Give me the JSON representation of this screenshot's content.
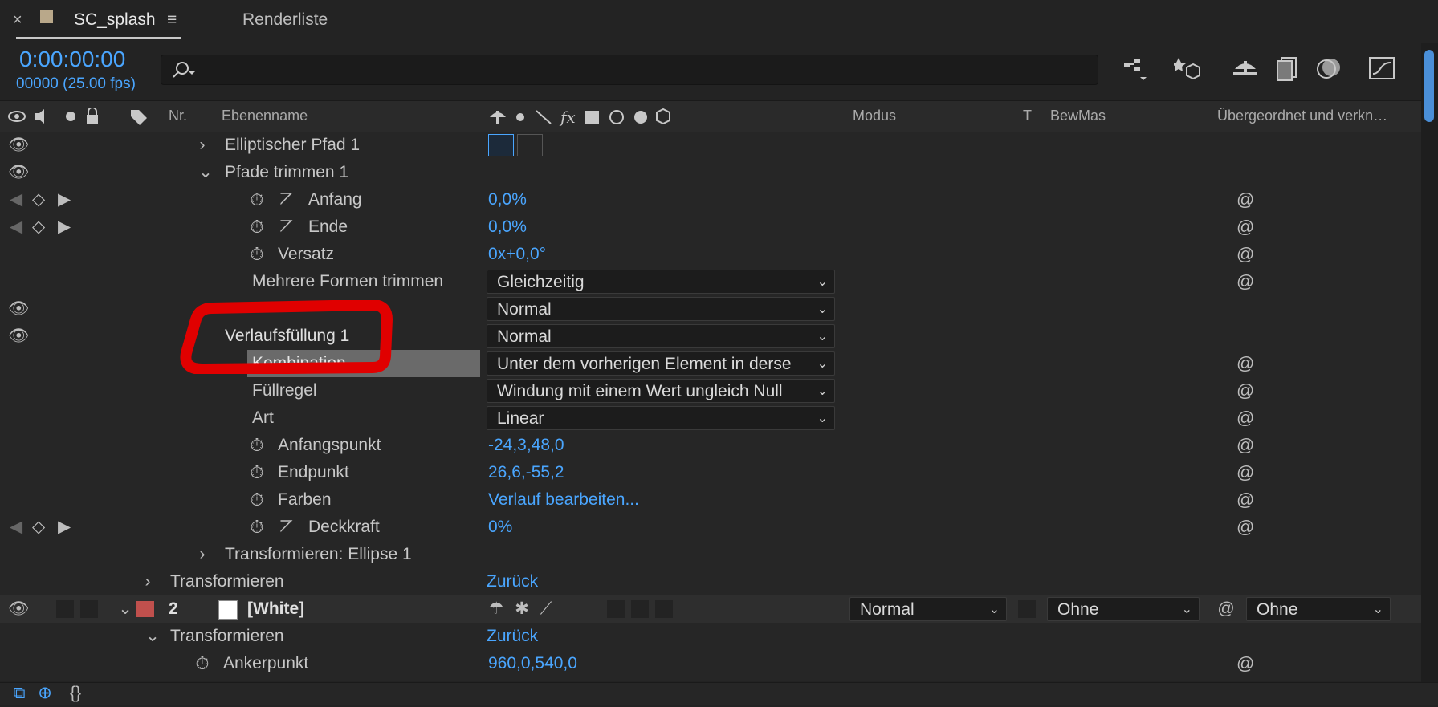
{
  "tabs": {
    "close_glyph": "×",
    "comp_name": "SC_splash",
    "menu_glyph": "≡",
    "render_queue": "Renderliste"
  },
  "time": {
    "timecode": "0:00:00:00",
    "frames_fps": "00000 (25.00 fps)"
  },
  "search": {
    "placeholder": ""
  },
  "columns": {
    "nr": "Nr.",
    "layer_name": "Ebenenname",
    "mode": "Modus",
    "t": "T",
    "trkmat": "BewMas",
    "parent": "Übergeordnet und verkn…"
  },
  "rows": {
    "r1": {
      "name": "Elliptischer Pfad 1"
    },
    "r2": {
      "name": "Pfade trimmen 1"
    },
    "r3": {
      "name": "Anfang",
      "value": "0,0%"
    },
    "r4": {
      "name": "Ende",
      "value": "0,0%"
    },
    "r5": {
      "name": "Versatz",
      "value": "0x+0,0°"
    },
    "r6": {
      "name": "Mehrere Formen trimmen",
      "value": "Gleichzeitig"
    },
    "r7": {
      "value": "Normal"
    },
    "r8": {
      "name": "Verlaufsfüllung 1",
      "value": "Normal"
    },
    "r9": {
      "name": "Kombination",
      "value": "Unter dem vorherigen Element in derse"
    },
    "r10": {
      "name": "Füllregel",
      "value": "Windung mit einem Wert ungleich Null"
    },
    "r11": {
      "name": "Art",
      "value": "Linear"
    },
    "r12": {
      "name": "Anfangspunkt",
      "value": "-24,3,48,0"
    },
    "r13": {
      "name": "Endpunkt",
      "value": "26,6,-55,2"
    },
    "r14": {
      "name": "Farben",
      "value": "Verlauf bearbeiten..."
    },
    "r15": {
      "name": "Deckkraft",
      "value": "0%"
    },
    "r16": {
      "name": "Transformieren: Ellipse 1"
    },
    "r17": {
      "name": "Transformieren",
      "value": "Zurück"
    },
    "r18": {
      "number": "2",
      "name": "[White]",
      "mode": "Normal",
      "trkmat": "Ohne",
      "parent": "Ohne"
    },
    "r19": {
      "name": "Transformieren",
      "value": "Zurück"
    },
    "r20": {
      "name": "Ankerpunkt",
      "value": "960,0,540,0"
    }
  },
  "colors": {
    "background": "#232323",
    "accent_blue": "#4aa6ff",
    "annotation_red": "#e00000",
    "layer_label_red": "#c0504d"
  }
}
